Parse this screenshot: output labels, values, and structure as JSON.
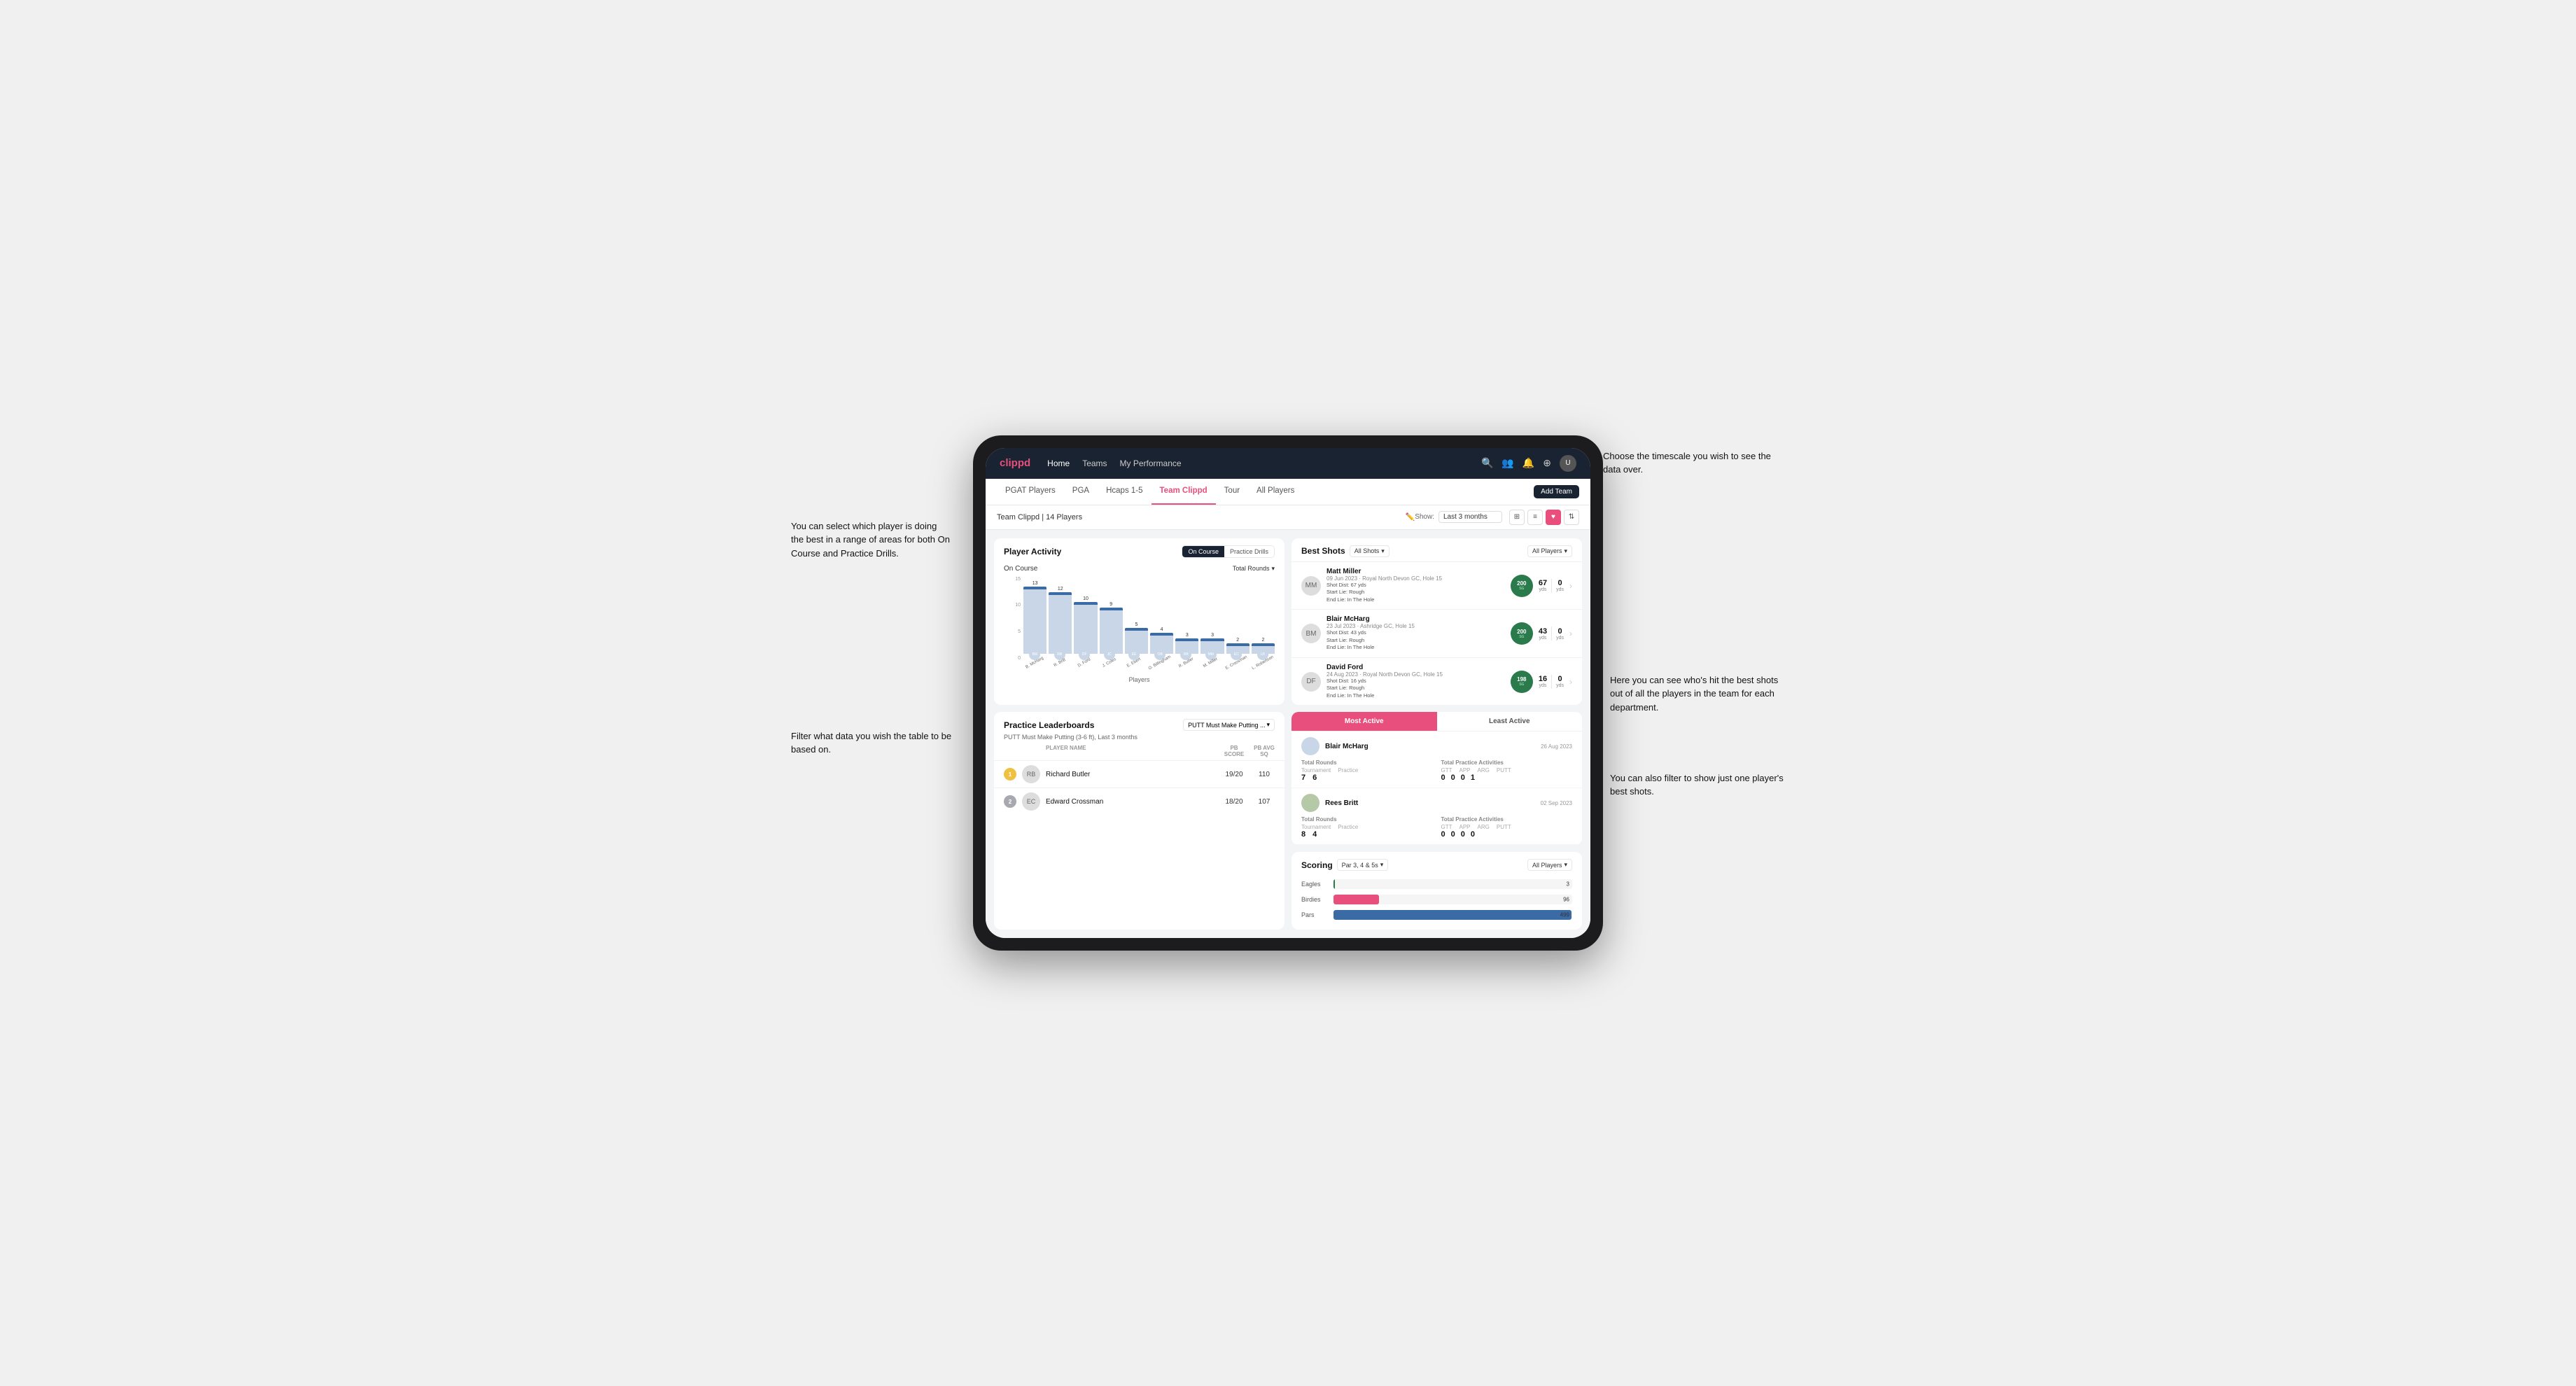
{
  "annotations": {
    "top_right": "Choose the timescale you wish to see the data over.",
    "left_top": "You can select which player is doing the best in a range of areas for both On Course and Practice Drills.",
    "left_bottom": "Filter what data you wish the table to be based on.",
    "right_mid": "Here you can see who's hit the best shots out of all the players in the team for each department.",
    "right_bottom": "You can also filter to show just one player's best shots."
  },
  "app": {
    "logo": "clippd",
    "nav_links": [
      "Home",
      "Teams",
      "My Performance"
    ],
    "tabs": [
      "PGAT Players",
      "PGA",
      "Hcaps 1-5",
      "Team Clippd",
      "Tour",
      "All Players"
    ],
    "active_tab": "Team Clippd",
    "add_team_btn": "Add Team",
    "team_name": "Team Clippd | 14 Players",
    "show_label": "Show:",
    "show_value": "Last 3 months"
  },
  "player_activity": {
    "title": "Player Activity",
    "toggle_on_course": "On Course",
    "toggle_practice": "Practice Drills",
    "section_title": "On Course",
    "filter_label": "Total Rounds",
    "y_labels": [
      "15",
      "10",
      "5",
      "0"
    ],
    "x_label": "Players",
    "bars": [
      {
        "name": "B. McHarg",
        "value": 13,
        "height": 87
      },
      {
        "name": "R. Britt",
        "value": 12,
        "height": 80
      },
      {
        "name": "D. Ford",
        "value": 10,
        "height": 67
      },
      {
        "name": "J. Coles",
        "value": 9,
        "height": 60
      },
      {
        "name": "E. Ebert",
        "value": 5,
        "height": 33
      },
      {
        "name": "O. Billingham",
        "value": 4,
        "height": 27
      },
      {
        "name": "R. Butler",
        "value": 3,
        "height": 20
      },
      {
        "name": "M. Miller",
        "value": 3,
        "height": 20
      },
      {
        "name": "E. Crossman",
        "value": 2,
        "height": 13
      },
      {
        "name": "L. Robertson",
        "value": 2,
        "height": 13
      }
    ]
  },
  "best_shots": {
    "title": "Best Shots",
    "filter1": "All Shots",
    "filter2": "All Players",
    "players": [
      {
        "name": "Matt Miller",
        "date": "09 Jun 2023",
        "course": "Royal North Devon GC",
        "hole": "Hole 15",
        "badge_val": "200",
        "badge_sub": "SG",
        "dist": "Shot Dist: 67 yds",
        "lie": "Start Lie: Rough",
        "end": "End Lie: In The Hole",
        "stat1": "67",
        "stat1_unit": "yds",
        "stat2": "0",
        "stat2_unit": "yds"
      },
      {
        "name": "Blair McHarg",
        "date": "23 Jul 2023",
        "course": "Ashridge GC",
        "hole": "Hole 15",
        "badge_val": "200",
        "badge_sub": "SG",
        "dist": "Shot Dist: 43 yds",
        "lie": "Start Lie: Rough",
        "end": "End Lie: In The Hole",
        "stat1": "43",
        "stat1_unit": "yds",
        "stat2": "0",
        "stat2_unit": "yds"
      },
      {
        "name": "David Ford",
        "date": "24 Aug 2023",
        "course": "Royal North Devon GC",
        "hole": "Hole 15",
        "badge_val": "198",
        "badge_sub": "SG",
        "dist": "Shot Dist: 16 yds",
        "lie": "Start Lie: Rough",
        "end": "End Lie: In The Hole",
        "stat1": "16",
        "stat1_unit": "yds",
        "stat2": "0",
        "stat2_unit": "yds"
      }
    ]
  },
  "practice_leaderboards": {
    "title": "Practice Leaderboards",
    "filter": "PUTT Must Make Putting ...",
    "subtitle": "PUTT Must Make Putting (3-6 ft), Last 3 months",
    "col_name": "PLAYER NAME",
    "col_score": "PB SCORE",
    "col_avg": "PB AVG SQ",
    "players": [
      {
        "rank": "1",
        "rank_type": "gold",
        "name": "Richard Butler",
        "score": "19/20",
        "avg": "110"
      },
      {
        "rank": "2",
        "rank_type": "silver",
        "name": "Edward Crossman",
        "score": "18/20",
        "avg": "107"
      }
    ]
  },
  "most_active": {
    "tab_active": "Most Active",
    "tab_inactive": "Least Active",
    "players": [
      {
        "name": "Blair McHarg",
        "date": "26 Aug 2023",
        "rounds_title": "Total Rounds",
        "rounds_tournament": "7",
        "rounds_practice": "6",
        "practice_title": "Total Practice Activities",
        "gtt": "0",
        "app": "0",
        "arg": "0",
        "putt": "1"
      },
      {
        "name": "Rees Britt",
        "date": "02 Sep 2023",
        "rounds_title": "Total Rounds",
        "rounds_tournament": "8",
        "rounds_practice": "4",
        "practice_title": "Total Practice Activities",
        "gtt": "0",
        "app": "0",
        "arg": "0",
        "putt": "0"
      }
    ]
  },
  "scoring": {
    "title": "Scoring",
    "filter1": "Par 3, 4 & 5s",
    "filter2": "All Players",
    "bars": [
      {
        "label": "Eagles",
        "value": 3,
        "max": 500,
        "color": "#2a7a4b"
      },
      {
        "label": "Birdies",
        "value": 96,
        "max": 500,
        "color": "#e94f7c"
      },
      {
        "label": "Pars",
        "value": 499,
        "max": 500,
        "color": "#3b6ba5"
      }
    ]
  }
}
